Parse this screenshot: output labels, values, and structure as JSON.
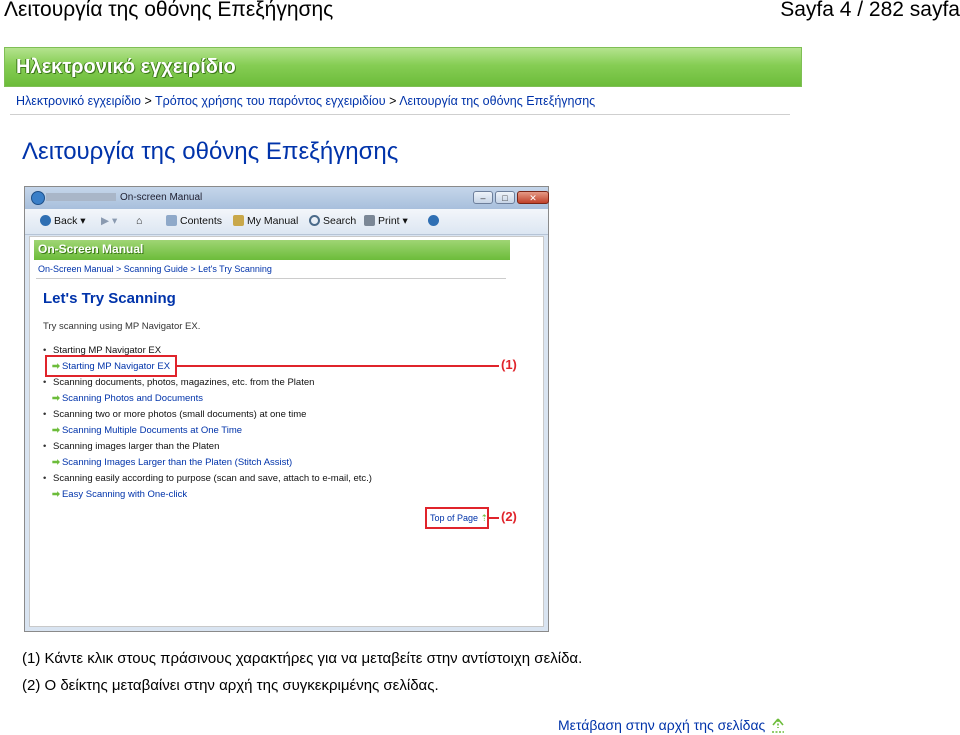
{
  "header": {
    "left_title": "Λειτουργία της οθόνης Επεξήγησης",
    "page_counter": "Sayfa 4 / 282 sayfa"
  },
  "banner": {
    "title": "Ηλεκτρονικό εγχειρίδιο"
  },
  "breadcrumb": {
    "items": [
      "Ηλεκτρονικό εγχειρίδιο",
      "Τρόπος χρήσης του παρόντος εγχειριδίου",
      "Λειτουργία της οθόνης Επεξήγησης"
    ],
    "separator": ">"
  },
  "page_title": "Λειτουργία της οθόνης Επεξήγησης",
  "screenshot": {
    "window_title": "On-screen Manual",
    "window_buttons": [
      "–",
      "□",
      "✕"
    ],
    "toolbar": {
      "back": "Back",
      "contents": "Contents",
      "my_manual": "My Manual",
      "search": "Search",
      "print": "Print"
    },
    "inner_banner": "On-Screen Manual",
    "inner_breadcrumb": "On-Screen Manual > Scanning Guide > Let's Try Scanning",
    "heading": "Let's Try Scanning",
    "intro": "Try scanning using MP Navigator EX.",
    "items": [
      {
        "kind": "bullet",
        "text": "Starting MP Navigator EX"
      },
      {
        "kind": "link",
        "text": "Starting MP Navigator EX"
      },
      {
        "kind": "bullet",
        "text": "Scanning documents, photos, magazines, etc. from the Platen"
      },
      {
        "kind": "link",
        "text": "Scanning Photos and Documents"
      },
      {
        "kind": "bullet",
        "text": "Scanning two or more photos (small documents) at one time"
      },
      {
        "kind": "link",
        "text": "Scanning Multiple Documents at One Time"
      },
      {
        "kind": "bullet",
        "text": "Scanning images larger than the Platen"
      },
      {
        "kind": "link",
        "text": "Scanning Images Larger than the Platen (Stitch Assist)"
      },
      {
        "kind": "bullet",
        "text": "Scanning easily according to purpose (scan and save, attach to e-mail, etc.)"
      },
      {
        "kind": "link",
        "text": "Easy Scanning with One-click"
      }
    ],
    "top_of_page": "Top of Page",
    "callouts": [
      "(1)",
      "(2)"
    ]
  },
  "notes": [
    "(1) Κάντε κλικ στους πράσινους χαρακτήρες για να μεταβείτε στην αντίστοιχη σελίδα.",
    "(2) Ο δείκτης μεταβαίνει στην αρχή της συγκεκριμένης σελίδας."
  ],
  "back_to_top": "Μετάβαση στην αρχή της σελίδας",
  "colors": {
    "link_blue": "#0033aa",
    "banner_green": "#6cbc3a",
    "callout_red": "#e0242b"
  }
}
